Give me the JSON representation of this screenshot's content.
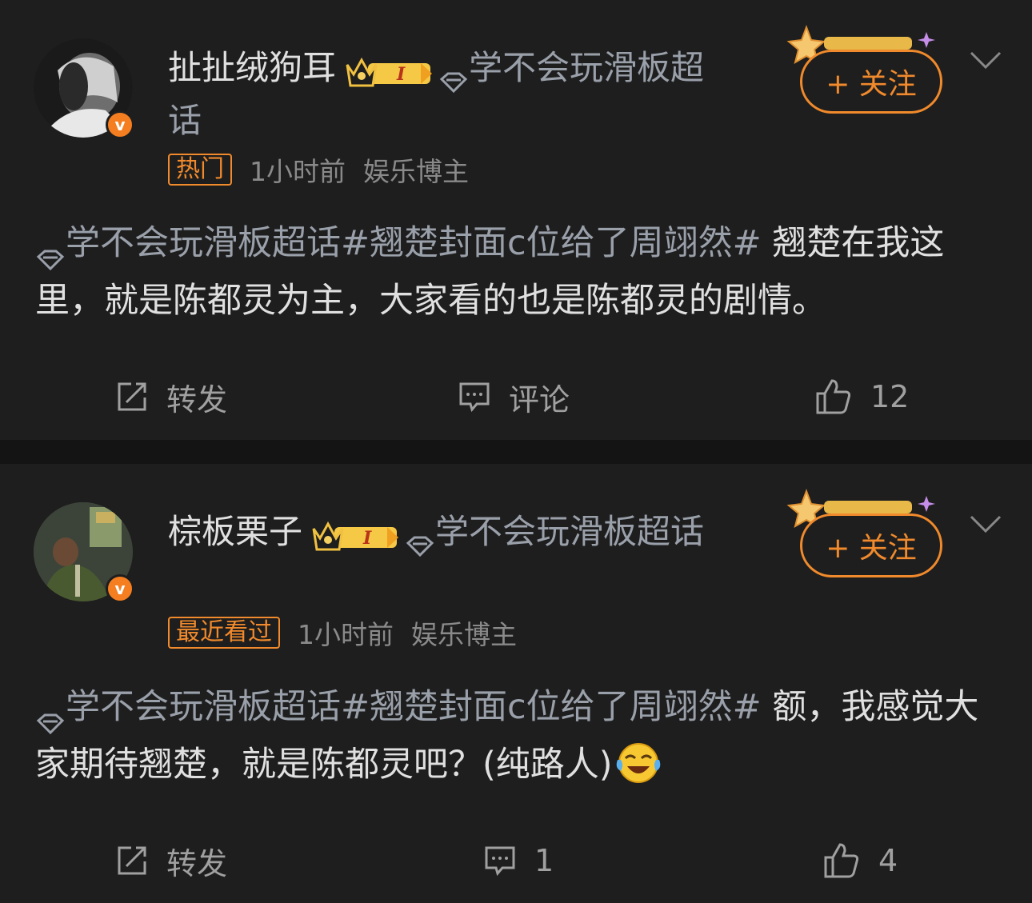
{
  "posts": [
    {
      "username": "扯扯绒狗耳",
      "badge_level": "I",
      "supertopic_inline": "学不会玩滑板超话",
      "tag": "热门",
      "time": "1小时前",
      "role": "娱乐博主",
      "follow_label": "+ 关注",
      "body_topic": "学不会玩滑板超话#翘楚封面c位给了周翊然#",
      "body_text": " 翘楚在我这里，就是陈都灵为主，大家看的也是陈都灵的剧情。",
      "repost_label": "转发",
      "comment_label": "评论",
      "like_count": "12"
    },
    {
      "username": "棕板栗子",
      "badge_level": "I",
      "supertopic_inline": "学不会玩滑板超话",
      "tag": "最近看过",
      "time": "1小时前",
      "role": "娱乐博主",
      "follow_label": "+ 关注",
      "body_topic": "学不会玩滑板超话#翘楚封面c位给了周翊然#",
      "body_text": " 额，我感觉大家期待翘楚，就是陈都灵吧？(纯路人)",
      "repost_label": "转发",
      "comment_count": "1",
      "like_count": "4"
    }
  ],
  "icons": {
    "verified": "v",
    "crown": "crown-icon",
    "gem": "diamond-icon",
    "repost": "repost-icon",
    "comment": "comment-icon",
    "like": "thumbs-up-icon",
    "more": "chevron-down-icon",
    "emoji": "laughing-crying-emoji"
  },
  "colors": {
    "accent": "#f08a2c",
    "background": "#1e1e1e",
    "topic": "#9aa0aa"
  }
}
